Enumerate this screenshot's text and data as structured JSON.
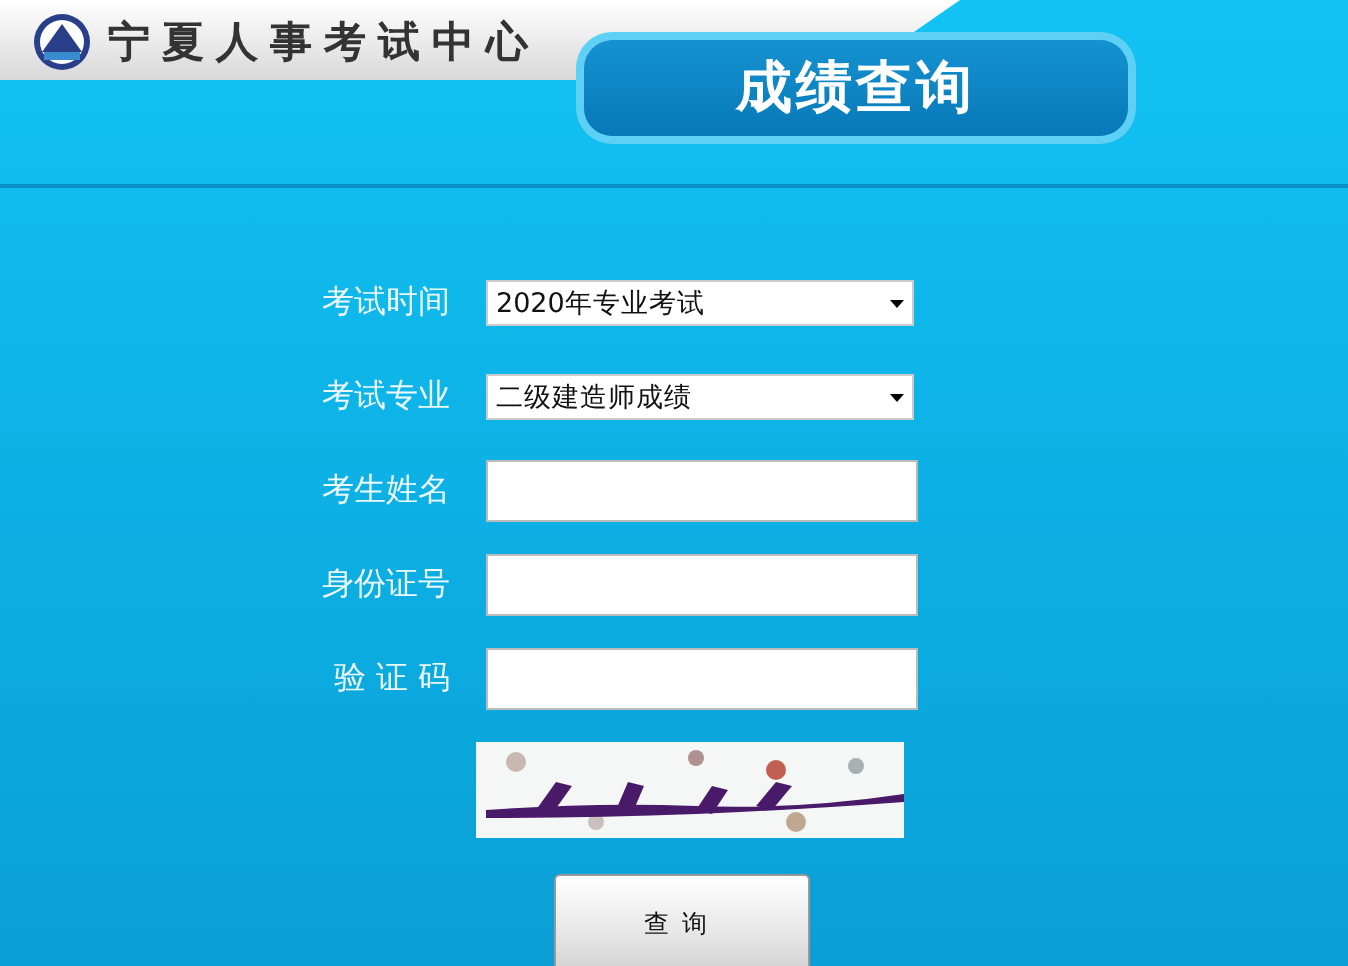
{
  "header": {
    "site_name": "宁夏人事考试中心",
    "page_title": "成绩查询"
  },
  "form": {
    "fields": [
      {
        "kind": "select",
        "label": "考试时间",
        "value": "2020年专业考试"
      },
      {
        "kind": "select",
        "label": "考试专业",
        "value": "二级建造师成绩"
      },
      {
        "kind": "input",
        "label": "考生姓名"
      },
      {
        "kind": "input",
        "label": "身份证号"
      },
      {
        "kind": "input",
        "label": "验 证 码"
      }
    ],
    "submit": "查询"
  }
}
